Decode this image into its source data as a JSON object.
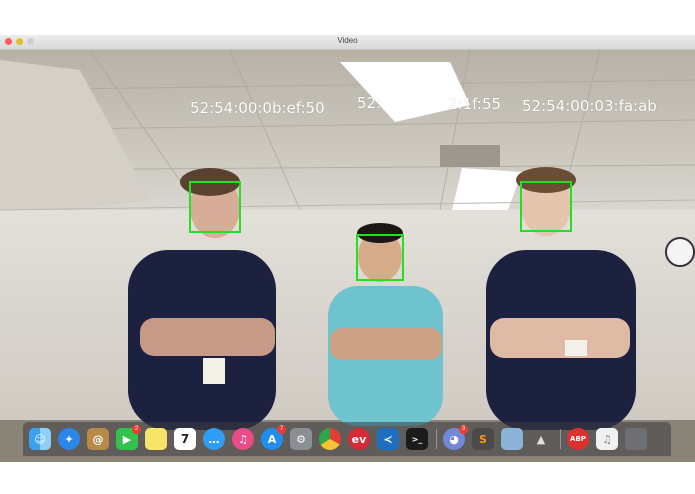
{
  "window": {
    "title": "Video"
  },
  "overlay": {
    "mac_left": "52:54:00:0b:ef:50",
    "mac_middle": "52:",
    "mac_middle_tail": "2:1f:55",
    "mac_right": "52:54:00:03:fa:ab"
  },
  "dock": {
    "badges": {
      "facetime": "2",
      "app_store": "7",
      "discord": "3"
    },
    "calendar_day": "7",
    "items": [
      "finder-icon",
      "safari-icon",
      "contacts-icon",
      "facetime-icon",
      "notes-icon",
      "calendar-icon",
      "messages-icon",
      "itunes-icon",
      "app-store-icon",
      "system-preferences-icon",
      "chrome-icon",
      "expressvpn-icon",
      "vscode-icon",
      "terminal-icon",
      "discord-icon",
      "sublime-icon",
      "preview-icon",
      "rocket-icon",
      "adblock-icon",
      "music-file-icon",
      "trash-icon"
    ]
  },
  "colors": {
    "face_box": "#23e023",
    "overlay_text": "#ffffff"
  }
}
